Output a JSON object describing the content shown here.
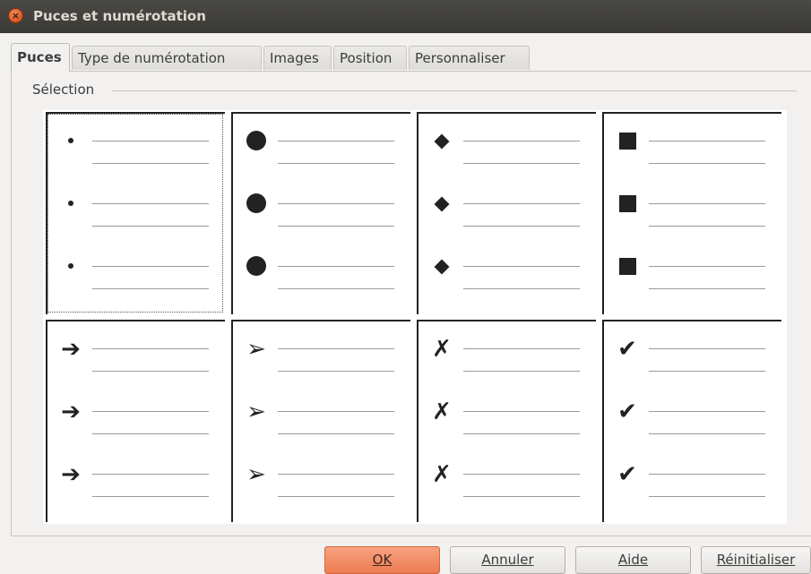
{
  "window": {
    "title": "Puces et numérotation"
  },
  "tabs": [
    {
      "label": "Puces",
      "active": true
    },
    {
      "label": "Type de numérotation"
    },
    {
      "label": "Images"
    },
    {
      "label": "Position"
    },
    {
      "label": "Personnaliser"
    }
  ],
  "selection": {
    "legend": "Sélection",
    "bullets": [
      {
        "name": "small-dot",
        "selected": true
      },
      {
        "name": "large-circle"
      },
      {
        "name": "diamond"
      },
      {
        "name": "square"
      },
      {
        "name": "arrow",
        "glyph": "➔"
      },
      {
        "name": "arrowhead",
        "glyph": "➢"
      },
      {
        "name": "x-mark",
        "glyph": "✗"
      },
      {
        "name": "check-mark",
        "glyph": "✔"
      }
    ]
  },
  "buttons": {
    "ok": "OK",
    "cancel": "Annuler",
    "help": "Aide",
    "reset": "Réinitialiser"
  },
  "colors": {
    "default_button": "#ee7c52",
    "close_button": "#d9531e"
  }
}
